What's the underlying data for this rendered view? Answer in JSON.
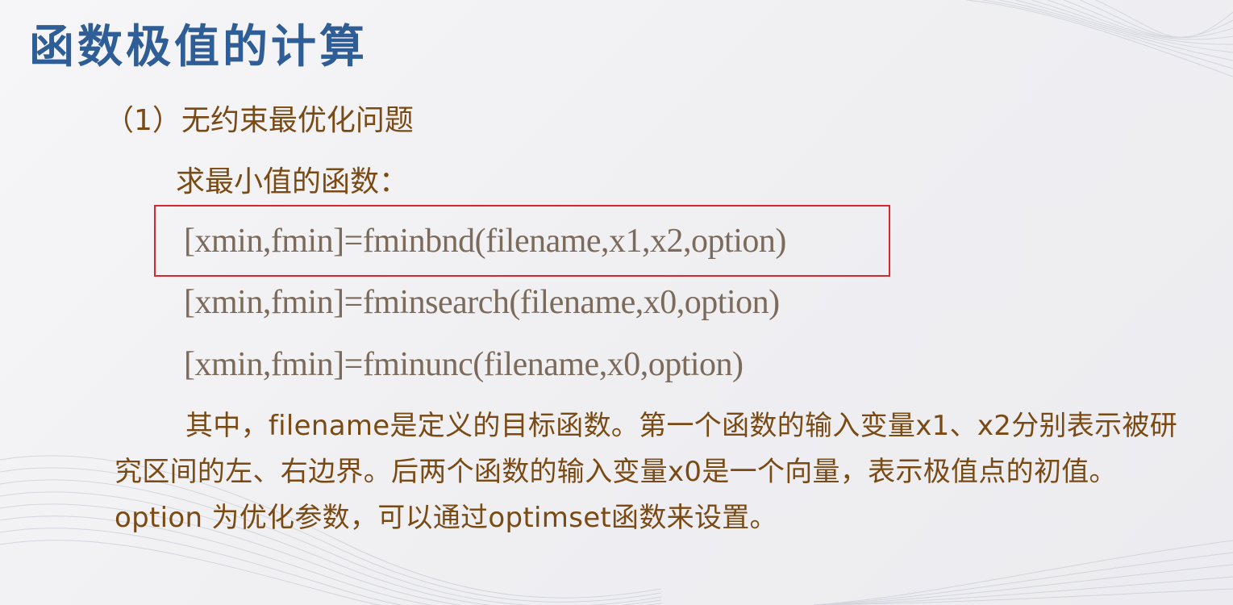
{
  "slide": {
    "title": "函数极值的计算",
    "subtitle": "（1）无约束最优化问题",
    "subheading": "求最小值的函数：",
    "functions": [
      "[xmin,fmin]=fminbnd(filename,x1,x2,option)",
      "[xmin,fmin]=fminsearch(filename,x0,option)",
      "[xmin,fmin]=fminunc(filename,x0,option)"
    ],
    "description": "其中，filename是定义的目标函数。第一个函数的输入变量x1、x2分别表示被研究区间的左、右边界。后两个函数的输入变量x0是一个向量，表示极值点的初值。option 为优化参数，可以通过optimset函数来设置。"
  },
  "colors": {
    "title": "#2f5d95",
    "text": "#7a4a14",
    "code": "#7c6a5a",
    "highlight_border": "#d6262e",
    "background": "#f2f2f5"
  }
}
